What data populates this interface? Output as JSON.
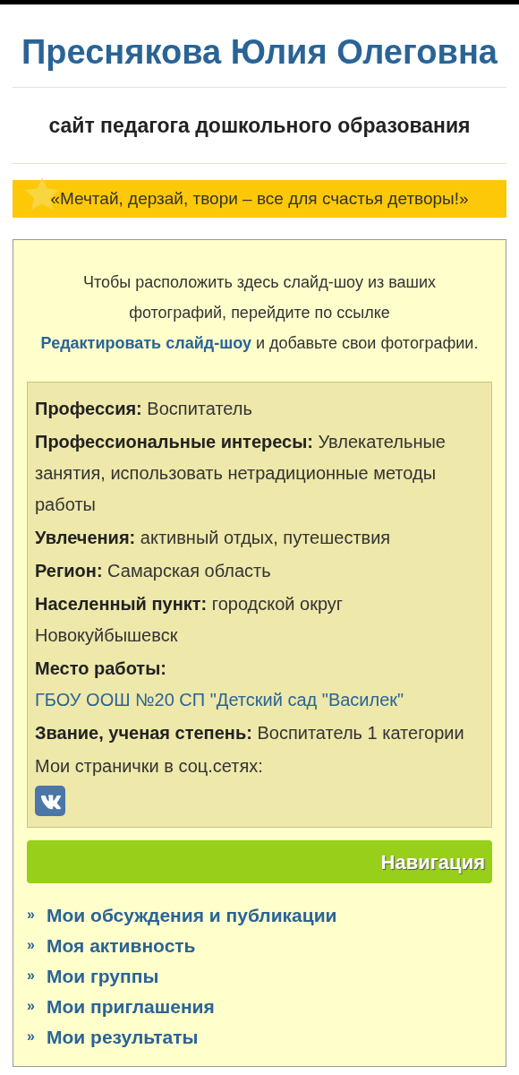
{
  "header": {
    "title": "Преснякова Юлия Олеговна",
    "subtitle": "сайт педагога дошкольного образования",
    "motto": "«Мечтай, дерзай, твори – все для счастья детворы!»"
  },
  "slideshow_note": {
    "before": "Чтобы расположить здесь слайд-шоу из ваших фотографий, перейдите по ссылке",
    "link": "Редактировать слайд-шоу",
    "after": "и добавьте свои фотографии."
  },
  "profile": {
    "fields": [
      {
        "label": "Профессия:",
        "value": "Воспитатель",
        "kind": "text"
      },
      {
        "label": "Профессиональные интересы:",
        "value": "Увлекательные занятия, использовать нетрадиционные методы работы",
        "kind": "text"
      },
      {
        "label": "Увлечения:",
        "value": "активный отдых, путешествия",
        "kind": "text"
      },
      {
        "label": "Регион:",
        "value": "Самарская область",
        "kind": "text"
      },
      {
        "label": "Населенный пункт:",
        "value": "городской округ Новокуйбышевск",
        "kind": "text"
      },
      {
        "label": "Место работы:",
        "value": "ГБОУ ООШ №20 СП \"Детский сад \"Василек\"",
        "kind": "link"
      },
      {
        "label": "Звание, ученая степень:",
        "value": "Воспитатель 1 категории",
        "kind": "text"
      }
    ],
    "social_label": "Мои странички в соц.сетях:",
    "social_links": [
      {
        "kind": "vk"
      }
    ]
  },
  "navigation": {
    "title": "Навигация",
    "items": [
      "Мои обсуждения и публикации",
      "Моя активность",
      "Мои группы",
      "Мои приглашения",
      "Мои результаты"
    ],
    "marker": "»"
  }
}
